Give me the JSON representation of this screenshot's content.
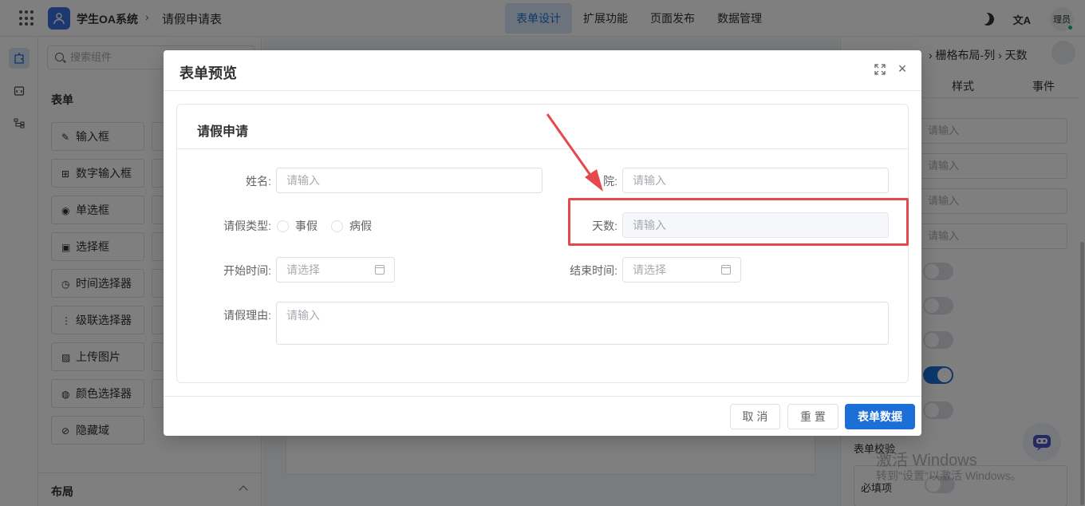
{
  "topbar": {
    "app_name": "学生OA系统",
    "breadcrumb_sep": "›",
    "page_name": "请假申请表",
    "nav": [
      {
        "label": "表单设计",
        "active": true
      },
      {
        "label": "扩展功能",
        "active": false
      },
      {
        "label": "页面发布",
        "active": false
      },
      {
        "label": "数据管理",
        "active": false
      }
    ],
    "translate_glyph": "文A",
    "user": "理员"
  },
  "components": {
    "search_placeholder": "搜索组件",
    "section_form": "表单",
    "items": [
      {
        "icon": "pencil-icon",
        "glyph": "✎",
        "label": "输入框"
      },
      {
        "icon": "number-input-icon",
        "glyph": "⊞",
        "label": "数字输入框"
      },
      {
        "icon": "radio-icon",
        "glyph": "◉",
        "label": "单选框"
      },
      {
        "icon": "select-icon",
        "glyph": "▣",
        "label": "选择框"
      },
      {
        "icon": "clock-icon",
        "glyph": "◷",
        "label": "时间选择器"
      },
      {
        "icon": "cascader-icon",
        "glyph": "⋮",
        "label": "级联选择器"
      },
      {
        "icon": "image-icon",
        "glyph": "▨",
        "label": "上传图片"
      },
      {
        "icon": "palette-icon",
        "glyph": "◍",
        "label": "颜色选择器"
      },
      {
        "icon": "eye-off-icon",
        "glyph": "⊘",
        "label": "隐藏域"
      }
    ],
    "section_layout": "布局"
  },
  "right_panel": {
    "breadcrumb": "› 栅格布局-列 › 天数",
    "tabs": [
      "样式",
      "事件"
    ],
    "input_placeholders": [
      "请输入",
      "请输入",
      "请输入",
      "请输入"
    ],
    "switches": [
      false,
      false,
      false,
      true,
      false
    ],
    "validation_label": "表单校验",
    "required_label": "必填项"
  },
  "watermark": {
    "line1": "激活 Windows",
    "line2": "转到\"设置\"以激活 Windows。"
  },
  "dialog": {
    "title": "表单预览",
    "card_title": "请假申请",
    "fields": {
      "name_label": "姓名:",
      "name_placeholder": "请输入",
      "college_label": "院:",
      "college_placeholder": "请输入",
      "leave_type_label": "请假类型:",
      "leave_options": [
        "事假",
        "病假"
      ],
      "days_label": "天数:",
      "days_placeholder": "请输入",
      "start_label": "开始时间:",
      "start_placeholder": "请选择",
      "end_label": "结束时间:",
      "end_placeholder": "请选择",
      "reason_label": "请假理由:",
      "reason_placeholder": "请输入"
    },
    "buttons": {
      "cancel": "取 消",
      "reset": "重 置",
      "submit": "表单数据"
    }
  },
  "colors": {
    "primary": "#1d6fd8",
    "highlight": "#e5484d",
    "overlay": "rgba(0,0,0,0.5)"
  }
}
